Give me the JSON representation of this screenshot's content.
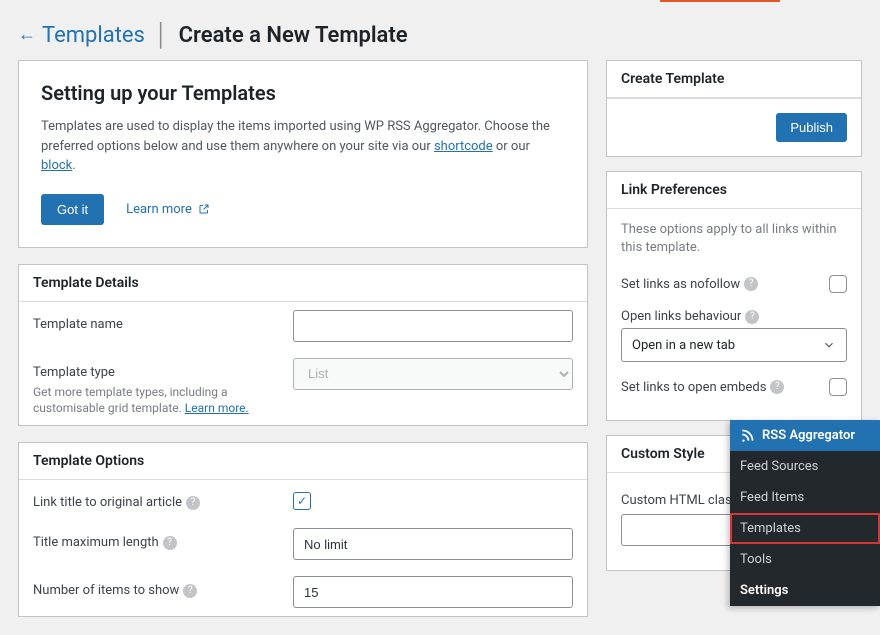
{
  "breadcrumb": {
    "back": "Templates",
    "current": "Create a New Template"
  },
  "intro": {
    "heading": "Setting up your Templates",
    "body_pre": "Templates are used to display the items imported using WP RSS Aggregator. Choose the preferred options below and use them anywhere on your site via our ",
    "link1": "shortcode",
    "body_mid": " or our ",
    "link2": "block",
    "body_post": ".",
    "got_it": "Got it",
    "learn_more": "Learn more"
  },
  "details": {
    "title": "Template Details",
    "name_label": "Template name",
    "name_value": "",
    "type_label": "Template type",
    "type_hint_pre": "Get more template types, including a customisable grid template. ",
    "type_hint_link": "Learn more.",
    "type_value": "List"
  },
  "options": {
    "title": "Template Options",
    "link_title_label": "Link title to original article",
    "link_title_checked": true,
    "title_max_label": "Title maximum length",
    "title_max_value": "No limit",
    "num_items_label": "Number of items to show",
    "num_items_value": "15"
  },
  "create": {
    "title": "Create Template",
    "publish": "Publish"
  },
  "links": {
    "title": "Link Preferences",
    "note": "These options apply to all links within this template.",
    "nofollow": "Set links as nofollow",
    "behaviour_label": "Open links behaviour",
    "behaviour_value": "Open in a new tab",
    "embeds": "Set links to open embeds"
  },
  "custom": {
    "title": "Custom Style",
    "class_label": "Custom HTML class"
  },
  "menu": {
    "head": "RSS Aggregator",
    "items": [
      "Feed Sources",
      "Feed Items",
      "Templates",
      "Tools",
      "Settings"
    ]
  }
}
